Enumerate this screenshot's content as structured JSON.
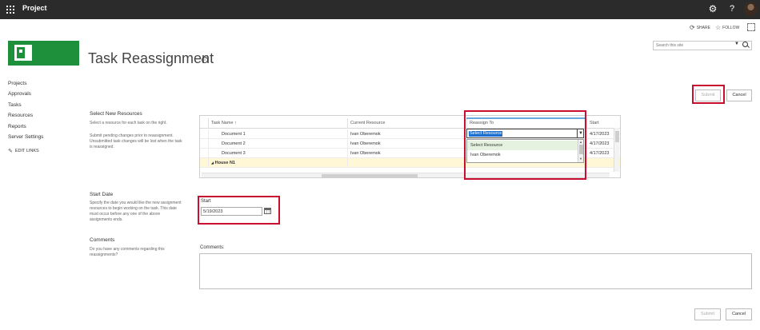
{
  "suitebar": {
    "app_title": "Project",
    "help_glyph": "?"
  },
  "actions": {
    "share": "SHARE",
    "follow": "FOLLOW"
  },
  "page": {
    "title": "Task Reassignment"
  },
  "search": {
    "placeholder": "Search this site"
  },
  "nav": {
    "items": [
      {
        "label": "Projects"
      },
      {
        "label": "Approvals"
      },
      {
        "label": "Tasks"
      },
      {
        "label": "Resources"
      },
      {
        "label": "Reports"
      },
      {
        "label": "Server Settings"
      }
    ],
    "edit_links": "EDIT LINKS"
  },
  "buttons": {
    "submit": "Submit",
    "cancel": "Cancel"
  },
  "sections": {
    "resources": {
      "title": "Select New Resources",
      "desc1": "Select a resource for each task on the right.",
      "desc2": "Submit pending changes prior to reassignment. Unsubmitted task changes will be lost when the task is reassigned."
    },
    "start_date": {
      "title": "Start Date",
      "desc": "Specify the date you would like the new assignment resources to begin working on the task. This date must occur before any one of the above assignments ends."
    },
    "comments": {
      "title": "Comments",
      "desc": "Do you have any comments regarding this reassignments?"
    }
  },
  "grid": {
    "columns": [
      "Task Name",
      "Current Resource",
      "Reassign To",
      "Start"
    ],
    "sort_glyph": "↑",
    "rows": [
      {
        "task": "Document 1",
        "resource": "Ivan Oberemok",
        "start": "4/17/2023"
      },
      {
        "task": "Document 2",
        "resource": "Ivan Oberemok",
        "start": "4/17/2023"
      },
      {
        "task": "Document 3",
        "resource": "Ivan Oberemok",
        "start": "4/17/2023"
      }
    ],
    "group": {
      "label": "House N1"
    },
    "dropdown": {
      "selected": "Select Resource",
      "options": [
        "Select Resource",
        "Ivan Oberemok"
      ]
    }
  },
  "start": {
    "label": "Start",
    "value": "5/19/2023"
  },
  "comments": {
    "label": "Comments:"
  }
}
